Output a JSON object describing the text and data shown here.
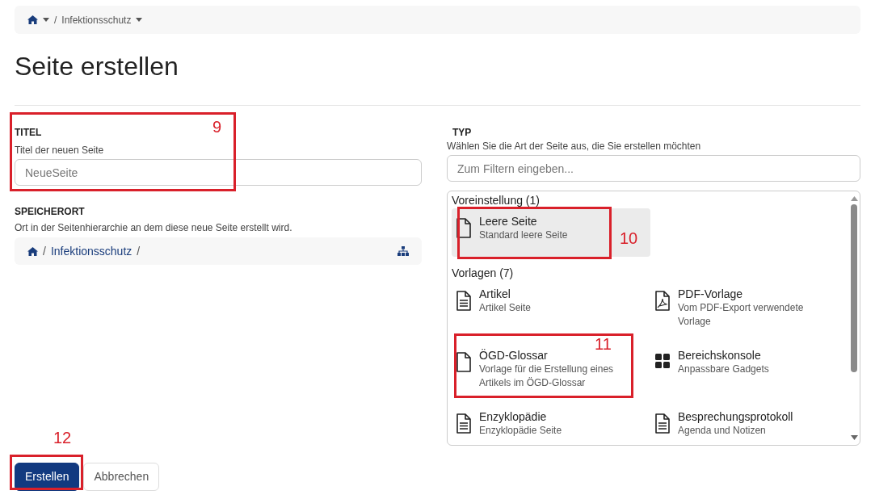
{
  "breadcrumb": {
    "separator": "/",
    "items": [
      {
        "kind": "home"
      },
      {
        "kind": "text",
        "label": "Infektionsschutz"
      }
    ]
  },
  "heading": "Seite erstellen",
  "title_field": {
    "label": "TITEL",
    "help": "Titel der neuen Seite",
    "placeholder": "NeueSeite"
  },
  "location": {
    "label": "SPEICHERORT",
    "help": "Ort in der Seitenhierarchie an dem diese neue Seite erstellt wird.",
    "path": [
      "Infektionsschutz"
    ],
    "separator": "/"
  },
  "type": {
    "label": "TYP",
    "help": "Wählen Sie die Art der Seite aus, die Sie erstellen möchten",
    "filter_placeholder": "Zum Filtern eingeben...",
    "groups": [
      {
        "title": "Voreinstellung (1)",
        "items": [
          {
            "kind": "blank",
            "name": "Leere Seite",
            "description": "Standard leere Seite",
            "selected": true
          }
        ]
      },
      {
        "title": "Vorlagen (7)",
        "items": [
          {
            "kind": "text",
            "name": "Artikel",
            "description": "Artikel Seite",
            "selected": false
          },
          {
            "kind": "pdf",
            "name": "PDF-Vorlage",
            "description": "Vom PDF-Export verwendete Vorlage",
            "selected": false
          },
          {
            "kind": "blank",
            "name": "ÖGD-Glossar",
            "description": "Vorlage für die Erstellung eines Artikels im ÖGD-Glossar",
            "selected": false
          },
          {
            "kind": "grid",
            "name": "Bereichskonsole",
            "description": "Anpassbare Gadgets",
            "selected": false
          },
          {
            "kind": "text",
            "name": "Enzyklopädie",
            "description": "Enzyklopädie Seite",
            "selected": false
          },
          {
            "kind": "text",
            "name": "Besprechungsprotokoll",
            "description": "Agenda und Notizen",
            "selected": false
          }
        ]
      }
    ]
  },
  "buttons": [
    {
      "kind": "primary",
      "label": "Erstellen"
    },
    {
      "kind": "secondary",
      "label": "Abbrechen"
    }
  ],
  "annotations": [
    {
      "label": "9"
    },
    {
      "label": "10"
    },
    {
      "label": "11"
    },
    {
      "label": "12"
    }
  ]
}
